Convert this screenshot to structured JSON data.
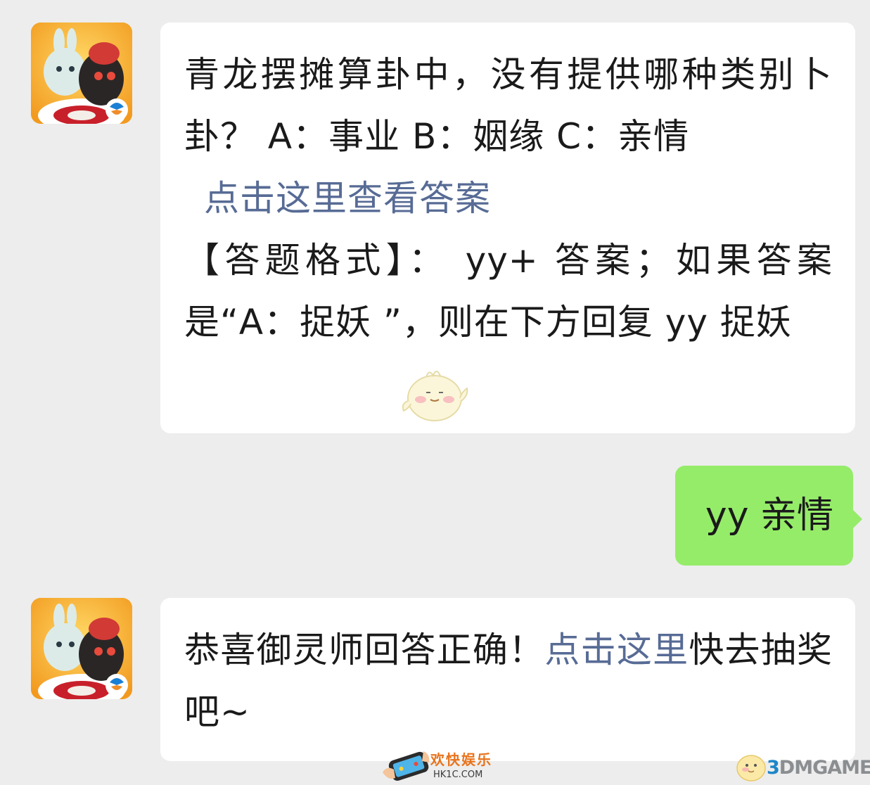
{
  "colors": {
    "background": "#ededed",
    "incoming_bubble": "#ffffff",
    "outgoing_bubble": "#95ec69",
    "link": "#576b95"
  },
  "messages": [
    {
      "sender": "bot",
      "avatar_icon": "game-character-avatar-icon",
      "question_line": "青龙摆摊算卦中，没有提供哪种类别卜卦？ A：事业 B：姻缘 C：亲情",
      "link_text": "点击这里查看答案",
      "format_text": "【答题格式】： yy+ 答案；如果答案是“A：捉妖 ”，则在下方回复 yy 捉妖",
      "sticker_icon": "chick-sticker-icon"
    },
    {
      "sender": "me",
      "text": "yy 亲情"
    },
    {
      "sender": "bot",
      "avatar_icon": "game-character-avatar-icon",
      "text_before": "恭喜御灵师回答正确！",
      "link_text": "点击这里",
      "text_after": "快去抽奖吧~"
    }
  ],
  "watermarks": {
    "left_top": "欢快娱乐",
    "left_bottom": "HK1C.COM",
    "right_digit": "3",
    "right_rest": "DMGAME"
  }
}
